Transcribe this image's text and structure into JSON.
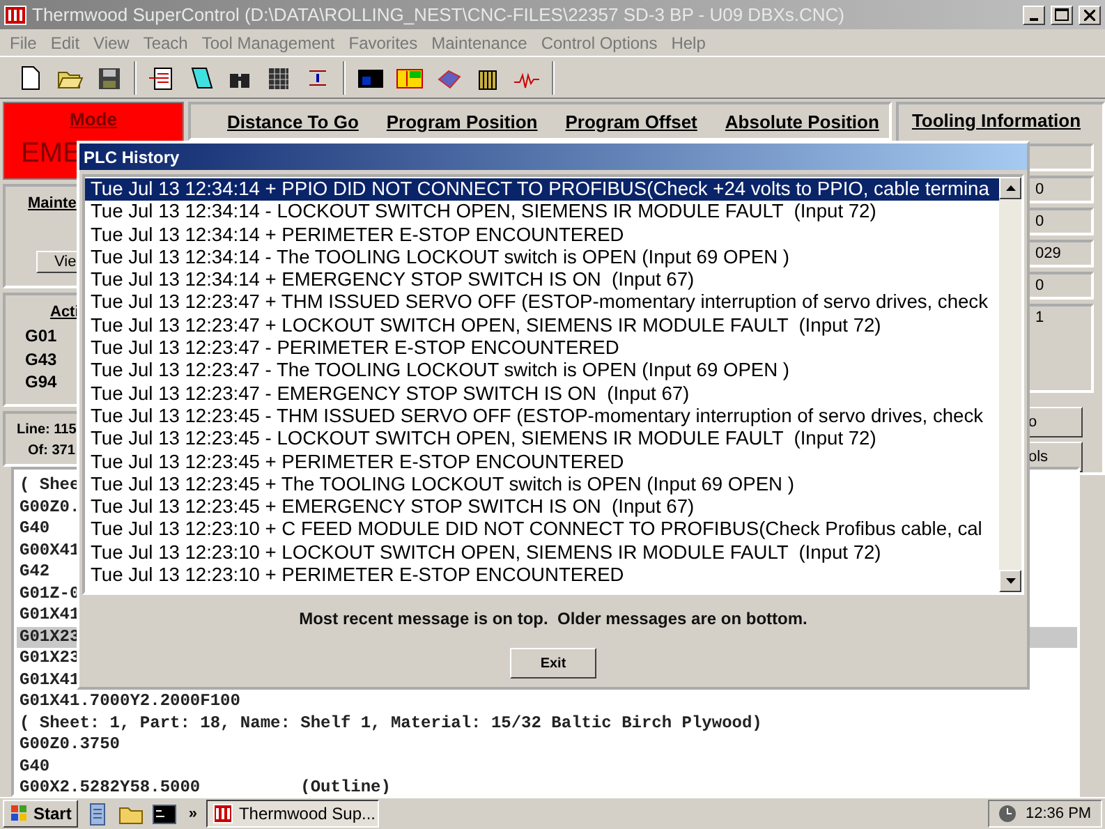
{
  "window": {
    "title": "Thermwood SuperControl (D:\\DATA\\ROLLING_NEST\\CNC-FILES\\22357 SD-3 BP - U09 DBXs.CNC)"
  },
  "menu": [
    "File",
    "Edit",
    "View",
    "Teach",
    "Tool Management",
    "Favorites",
    "Maintenance",
    "Control Options",
    "Help"
  ],
  "mode": {
    "label": "Mode",
    "value": "EME"
  },
  "position_tabs": [
    "Distance To Go",
    "Program Position",
    "Program Offset",
    "Absolute Position"
  ],
  "tooling": {
    "title": "Tooling Information",
    "fields": [
      "0",
      "0",
      "029",
      "0",
      "1"
    ],
    "buttons": [
      "o",
      "ols"
    ]
  },
  "maintenance": {
    "title": "Mainte",
    "button": "Vie"
  },
  "active_codes": {
    "title": "Acti",
    "codes": [
      "G01",
      "G43",
      "G94"
    ]
  },
  "line_info": {
    "line_label": "Line:",
    "line": "115",
    "of_label": "Of:",
    "of": "371"
  },
  "program": {
    "lines": [
      {
        "text": "( Shee",
        "selected": false
      },
      {
        "text": "G00Z0.",
        "selected": false
      },
      {
        "text": "G40",
        "selected": false
      },
      {
        "text": "G00X41",
        "selected": false
      },
      {
        "text": "G42",
        "selected": false
      },
      {
        "text": "G01Z-0",
        "selected": false
      },
      {
        "text": "G01X41",
        "selected": false
      },
      {
        "text": "G01X23",
        "selected": true
      },
      {
        "text": "G01X23",
        "selected": false
      },
      {
        "text": "G01X41",
        "selected": false
      },
      {
        "text": "G01X41.7000Y2.2000F100",
        "selected": false
      },
      {
        "text": "( Sheet: 1, Part: 18, Name: Shelf 1, Material: 15/32 Baltic Birch Plywood)",
        "selected": false
      },
      {
        "text": "G00Z0.3750",
        "selected": false
      },
      {
        "text": "G40",
        "selected": false
      },
      {
        "text": "G00X2.5282Y58.5000          (Outline)",
        "selected": false
      }
    ]
  },
  "dialog": {
    "title": "PLC History",
    "messages": [
      {
        "text": "Tue Jul 13 12:34:14 + PPIO DID NOT CONNECT TO PROFIBUS(Check +24 volts to PPIO, cable termina",
        "selected": true
      },
      {
        "text": "Tue Jul 13 12:34:14 - LOCKOUT SWITCH OPEN, SIEMENS IR MODULE FAULT  (Input 72)",
        "selected": false
      },
      {
        "text": "Tue Jul 13 12:34:14 + PERIMETER E-STOP ENCOUNTERED",
        "selected": false
      },
      {
        "text": "Tue Jul 13 12:34:14 - The TOOLING LOCKOUT switch is OPEN (Input 69 OPEN )",
        "selected": false
      },
      {
        "text": "Tue Jul 13 12:34:14 + EMERGENCY STOP SWITCH IS ON  (Input 67)",
        "selected": false
      },
      {
        "text": "Tue Jul 13 12:23:47 + THM ISSUED SERVO OFF (ESTOP-momentary interruption of servo drives, check",
        "selected": false
      },
      {
        "text": "Tue Jul 13 12:23:47 + LOCKOUT SWITCH OPEN, SIEMENS IR MODULE FAULT  (Input 72)",
        "selected": false
      },
      {
        "text": "Tue Jul 13 12:23:47 - PERIMETER E-STOP ENCOUNTERED",
        "selected": false
      },
      {
        "text": "Tue Jul 13 12:23:47 - The TOOLING LOCKOUT switch is OPEN (Input 69 OPEN )",
        "selected": false
      },
      {
        "text": "Tue Jul 13 12:23:47 - EMERGENCY STOP SWITCH IS ON  (Input 67)",
        "selected": false
      },
      {
        "text": "Tue Jul 13 12:23:45 - THM ISSUED SERVO OFF (ESTOP-momentary interruption of servo drives, check",
        "selected": false
      },
      {
        "text": "Tue Jul 13 12:23:45 - LOCKOUT SWITCH OPEN, SIEMENS IR MODULE FAULT  (Input 72)",
        "selected": false
      },
      {
        "text": "Tue Jul 13 12:23:45 + PERIMETER E-STOP ENCOUNTERED",
        "selected": false
      },
      {
        "text": "Tue Jul 13 12:23:45 + The TOOLING LOCKOUT switch is OPEN (Input 69 OPEN )",
        "selected": false
      },
      {
        "text": "Tue Jul 13 12:23:45 + EMERGENCY STOP SWITCH IS ON  (Input 67)",
        "selected": false
      },
      {
        "text": "Tue Jul 13 12:23:10 + C FEED MODULE DID NOT CONNECT TO PROFIBUS(Check Profibus cable, cal",
        "selected": false
      },
      {
        "text": "Tue Jul 13 12:23:10 + LOCKOUT SWITCH OPEN, SIEMENS IR MODULE FAULT  (Input 72)",
        "selected": false
      },
      {
        "text": "Tue Jul 13 12:23:10 + PERIMETER E-STOP ENCOUNTERED",
        "selected": false
      }
    ],
    "note": "Most recent message is on top.  Older messages are on bottom.",
    "button": "Exit"
  },
  "taskbar": {
    "start": "Start",
    "more": "»",
    "task": "Thermwood Sup...",
    "clock": "12:36 PM"
  }
}
